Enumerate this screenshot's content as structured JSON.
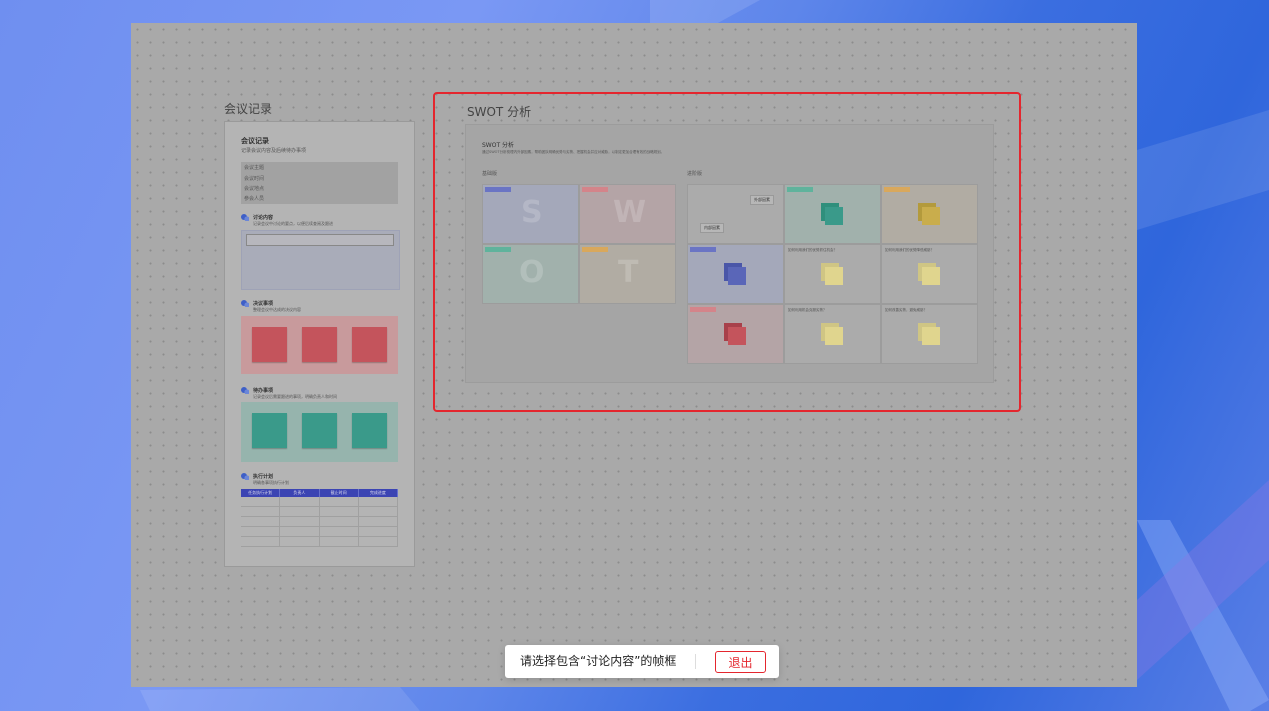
{
  "canvas": {
    "frames": [
      {
        "title": "会议记录"
      },
      {
        "title": "SWOT 分析"
      }
    ]
  },
  "meeting_doc": {
    "heading": "会议记录",
    "subtitle": "记录会议内容及后续待办事项",
    "info_rows": [
      "会议主题",
      "会议时间",
      "会议地点",
      "参会人员"
    ],
    "sections": [
      {
        "title": "讨论内容",
        "desc": "记录会议中讨论的要点，以便后续查阅及跟进"
      },
      {
        "title": "决议事项",
        "desc": "整理会议中达成的决议内容"
      },
      {
        "title": "待办事项",
        "desc": "记录会议后需要跟进的事项，明确负责人和时间"
      },
      {
        "title": "执行计划",
        "desc": "明确各事项执行计划"
      }
    ],
    "table_headers": [
      "任务执行计划",
      "负责人",
      "截止时间",
      "完成进度"
    ],
    "colors": {
      "red_card": "#c4545c",
      "teal_card": "#3a9a8a",
      "red_band": "#c89a9c",
      "teal_band": "#96b4ad",
      "table_head": "#3b44b3"
    }
  },
  "swot": {
    "heading": "SWOT 分析",
    "desc": "通过SWOT分析梳理内外部因素，帮助团队明确优势与劣势、把握机会并应对威胁，以制定更加合理有效的战略规划。",
    "left_label": "基础版",
    "right_label": "进阶版",
    "letters": [
      "S",
      "W",
      "O",
      "T"
    ],
    "right_pills": [
      "外部因素",
      "内部因素"
    ],
    "questions": [
      "如何利用我们的优势抓住机会？",
      "如何利用我们的优势降低威胁？",
      "如何利用机会克服劣势？",
      "如何改善劣势，避免威胁？"
    ],
    "colors": {
      "s": "#6a74c4",
      "w": "#d4848a",
      "o": "#5fb39c",
      "t": "#d9a85c",
      "yellow": "#e0d58e"
    }
  },
  "toolbar": {
    "message": "请选择包含“讨论内容”的帧框",
    "exit_label": "退出"
  }
}
